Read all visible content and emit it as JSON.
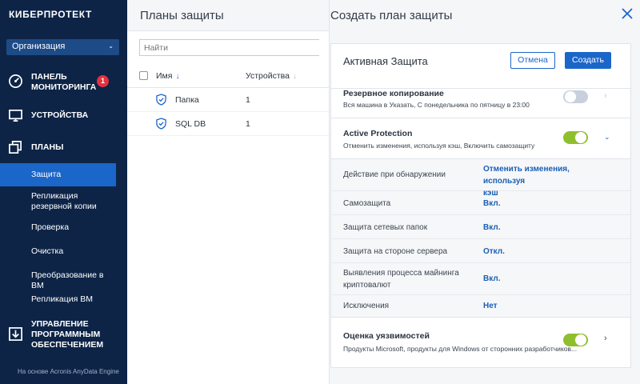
{
  "sidebar": {
    "logo": "КИБЕРПРОТЕКТ",
    "org_select": "Организация",
    "nav": {
      "monitoring_line1": "ПАНЕЛЬ",
      "monitoring_line2": "МОНИТОРИНГА",
      "monitoring_badge": "1",
      "devices": "УСТРОЙСТВА",
      "plans": "ПЛАНЫ",
      "software_line1": "УПРАВЛЕНИЕ",
      "software_line2": "ПРОГРАММНЫМ",
      "software_line3": "ОБЕСПЕЧЕНИЕМ"
    },
    "sub": {
      "protection": "Защита",
      "replication_line1": "Репликация",
      "replication_line2": "резервной копии",
      "validation": "Проверка",
      "cleanup": "Очистка",
      "conversion": "Преобразование в ВМ",
      "vm_replication": "Репликация ВМ"
    },
    "footer": "На основе Acronis AnyData Engine"
  },
  "plans_panel": {
    "title": "Планы защиты",
    "search_placeholder": "Найти",
    "columns": {
      "name": "Имя",
      "devices": "Устройства"
    },
    "rows": [
      {
        "name": "Папка",
        "count": "1"
      },
      {
        "name": "SQL DB",
        "count": "1"
      }
    ]
  },
  "create_panel": {
    "title": "Создать план защиты",
    "plan_name": "Активная Защита",
    "cancel": "Отмена",
    "create": "Создать",
    "backup": {
      "title": "Резервное копирование",
      "subtitle": "Вся машина в Указать, С понедельника по пятницу в 23:00",
      "enabled": false
    },
    "active_protection": {
      "title": "Active Protection",
      "subtitle": "Отменить изменения, используя кэш, Включить самозащиту",
      "enabled": true,
      "settings": [
        {
          "label_line1": "Действие при обнаружении",
          "value_line1": "Отменить изменения, используя",
          "value_line2": "кэш"
        },
        {
          "label_line1": "Самозащита",
          "value_line1": "Вкл."
        },
        {
          "label_line1": "Защита сетевых папок",
          "value_line1": "Вкл."
        },
        {
          "label_line1": "Защита на стороне сервера",
          "value_line1": "Откл."
        },
        {
          "label_line1": "Выявления процесса майнинга",
          "label_line2": "криптовалют",
          "value_line1": "Вкл."
        },
        {
          "label_line1": "Исключения",
          "value_line1": "Нет"
        }
      ]
    },
    "vulnerability": {
      "title": "Оценка уязвимостей",
      "subtitle": "Продукты Microsoft, продукты для Windows от сторонних разработчиков...",
      "enabled": true
    }
  },
  "colors": {
    "sidebar_bg": "#0d2447",
    "accent": "#1b66c9",
    "badge": "#e5313f",
    "toggle_on": "#8fbf2f",
    "toggle_off": "#c7d0dc"
  }
}
